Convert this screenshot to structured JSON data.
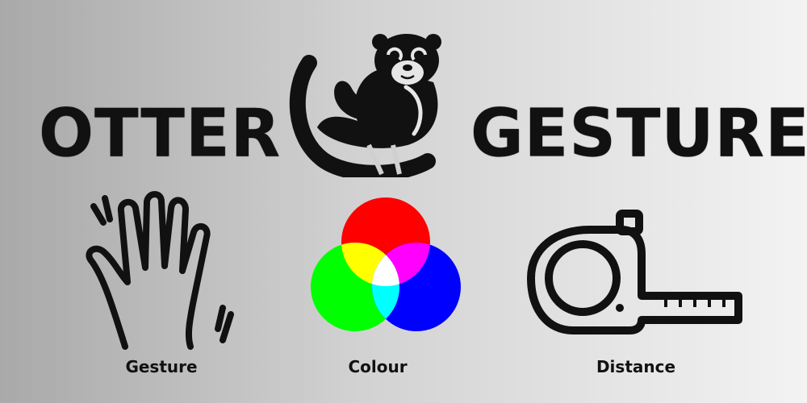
{
  "banner": {
    "title_left": "OTTER",
    "title_right": "GESTURE",
    "mascot_icon": "otter-mascot-icon",
    "text_color": "#111111",
    "background_colors": [
      "#a9a9a9",
      "#f3f3f3"
    ]
  },
  "features": [
    {
      "caption": "Gesture",
      "icon": "waving-hand-icon"
    },
    {
      "caption": "Colour",
      "icon": "rgb-circles-icon",
      "colors": [
        "#ff0000",
        "#00ff00",
        "#0000ff"
      ]
    },
    {
      "caption": "Distance",
      "icon": "tape-measure-icon"
    }
  ]
}
